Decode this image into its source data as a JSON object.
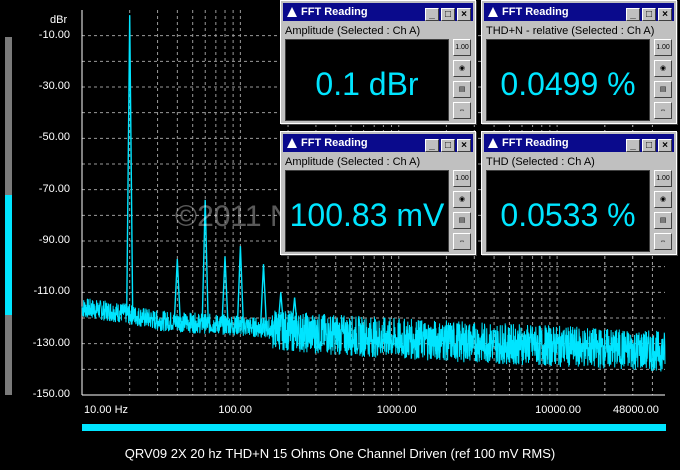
{
  "colors": {
    "trace": "#00e5ff",
    "grid": "#9a9a9a",
    "background": "#000000",
    "title_bar": "#0a0a8c"
  },
  "y_unit": "dBr",
  "windows": [
    {
      "title": "FFT Reading",
      "subtitle": "Amplitude (Selected : Ch A)",
      "value": "0.1 dBr"
    },
    {
      "title": "FFT Reading",
      "subtitle": "THD+N - relative (Selected : Ch A)",
      "value": "0.0499 %"
    },
    {
      "title": "FFT Reading",
      "subtitle": "Amplitude (Selected : Ch A)",
      "value": "100.83 mV"
    },
    {
      "title": "FFT Reading",
      "subtitle": "THD (Selected : Ch A)",
      "value": "0.0533 %"
    }
  ],
  "window_buttons": {
    "minimize": "_",
    "maximize": "□",
    "close": "×"
  },
  "tool_icons": [
    "number-format-icon",
    "meter-icon",
    "notepad-icon",
    "arrows-icon"
  ],
  "tool_label": "1.00",
  "caption": "QRV09 2X 20 hz THD+N 15 Ohms One Channel Driven (ref 100 mV RMS)",
  "watermark": "©2011 NwAvGuy.com",
  "chart_data": {
    "type": "line",
    "title": "",
    "xlabel": "",
    "ylabel": "dBr",
    "x_scale": "log",
    "xlim": [
      10,
      48000
    ],
    "ylim": [
      -150,
      0
    ],
    "x_tick_labels": [
      "10.00 Hz",
      "100.00",
      "1000.00",
      "10000.00",
      "48000.00"
    ],
    "y_tick_labels": [
      "-10.00",
      "-30.00",
      "-50.00",
      "-70.00",
      "-90.00",
      "-110.00",
      "-130.00",
      "-150.00"
    ],
    "series": [
      {
        "peaks": [
          {
            "x": 20,
            "y": -2
          },
          {
            "x": 40,
            "y": -97
          },
          {
            "x": 60,
            "y": -74
          },
          {
            "x": 80,
            "y": -96
          },
          {
            "x": 100,
            "y": -92
          },
          {
            "x": 140,
            "y": -99
          },
          {
            "x": 180,
            "y": -110
          },
          {
            "x": 220,
            "y": -112
          }
        ],
        "noise_floor": [
          {
            "x": 10,
            "y": -116
          },
          {
            "x": 18,
            "y": -118
          },
          {
            "x": 30,
            "y": -121
          },
          {
            "x": 100,
            "y": -123
          },
          {
            "x": 300,
            "y": -126
          },
          {
            "x": 1000,
            "y": -128
          },
          {
            "x": 10000,
            "y": -131
          },
          {
            "x": 48000,
            "y": -133
          }
        ]
      }
    ],
    "grid": true
  }
}
